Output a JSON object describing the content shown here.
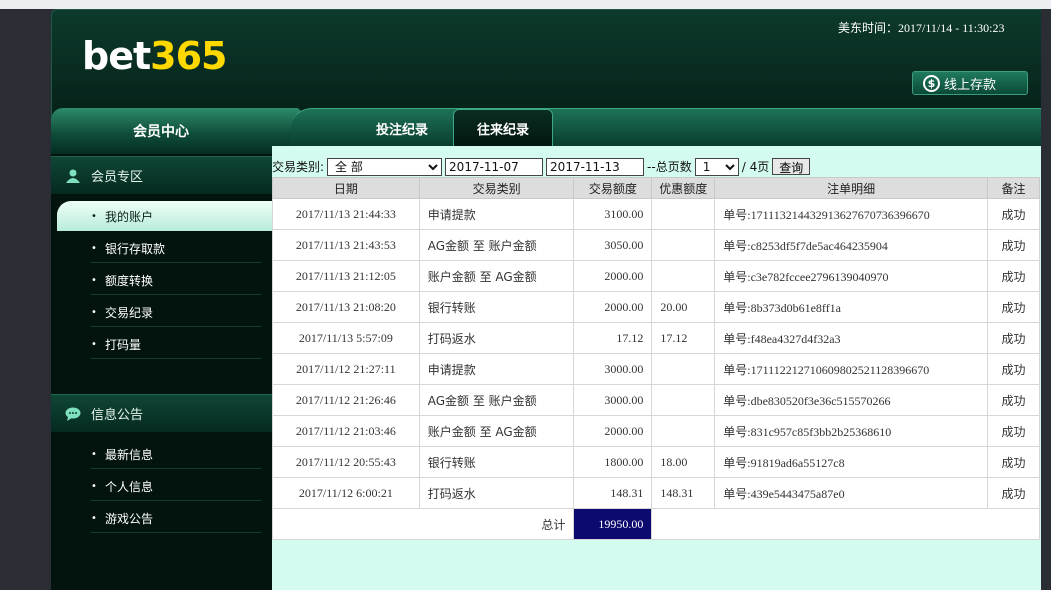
{
  "header": {
    "logo_part1": "bet",
    "logo_part2": "365",
    "clock": "美东时间：2017/11/14 - 11:30:23",
    "deposit_label": "线上存款",
    "deposit_icon": "dollar-circle-icon"
  },
  "member_center": "会员中心",
  "tabs": [
    {
      "label": "投注纪录"
    },
    {
      "label": "往来纪录"
    }
  ],
  "sidebar": {
    "section1": {
      "label": "会员专区",
      "icon": "user-icon"
    },
    "items1": [
      "我的账户",
      "银行存取款",
      "额度转换",
      "交易纪录",
      "打码量"
    ],
    "section2": {
      "label": "信息公告",
      "icon": "chat-bubble-icon"
    },
    "items2": [
      "最新信息",
      "个人信息",
      "游戏公告"
    ]
  },
  "filter": {
    "type_label": "交易类别:",
    "type_value": "全 部",
    "start_date": "2017-11-07",
    "end_date": "2017-11-13",
    "pages_label": "--总页数",
    "page_value": "1",
    "pages_total": "/ 4页",
    "query_label": "查询"
  },
  "table": {
    "headers": [
      "日期",
      "交易类别",
      "交易额度",
      "优惠额度",
      "注单明细",
      "备注"
    ],
    "rows": [
      [
        "2017/11/13 21:44:33",
        "申请提款",
        "3100.00",
        "",
        "单号:171113214432913627670736396670",
        "成功"
      ],
      [
        "2017/11/13 21:43:53",
        "AG金额 至 账户金额",
        "3050.00",
        "",
        "单号:c8253df5f7de5ac464235904",
        "成功"
      ],
      [
        "2017/11/13 21:12:05",
        "账户金额 至 AG金额",
        "2000.00",
        "",
        "单号:c3e782fccee2796139040970",
        "成功"
      ],
      [
        "2017/11/13 21:08:20",
        "银行转账",
        "2000.00",
        "20.00",
        "单号:8b373d0b61e8ff1a",
        "成功"
      ],
      [
        "2017/11/13 5:57:09",
        "打码返水",
        "17.12",
        "17.12",
        "单号:f48ea4327d4f32a3",
        "成功"
      ],
      [
        "2017/11/12 21:27:11",
        "申请提款",
        "3000.00",
        "",
        "单号:171112212710609802521128396670",
        "成功"
      ],
      [
        "2017/11/12 21:26:46",
        "AG金额 至 账户金额",
        "3000.00",
        "",
        "单号:dbe830520f3e36c515570266",
        "成功"
      ],
      [
        "2017/11/12 21:03:46",
        "账户金额 至 AG金额",
        "2000.00",
        "",
        "单号:831c957c85f3bb2b25368610",
        "成功"
      ],
      [
        "2017/11/12 20:55:43",
        "银行转账",
        "1800.00",
        "18.00",
        "单号:91819ad6a55127c8",
        "成功"
      ],
      [
        "2017/11/12 6:00:21",
        "打码返水",
        "148.31",
        "148.31",
        "单号:439e5443475a87e0",
        "成功"
      ]
    ],
    "total_label": "总计",
    "total_value": "19950.00"
  }
}
